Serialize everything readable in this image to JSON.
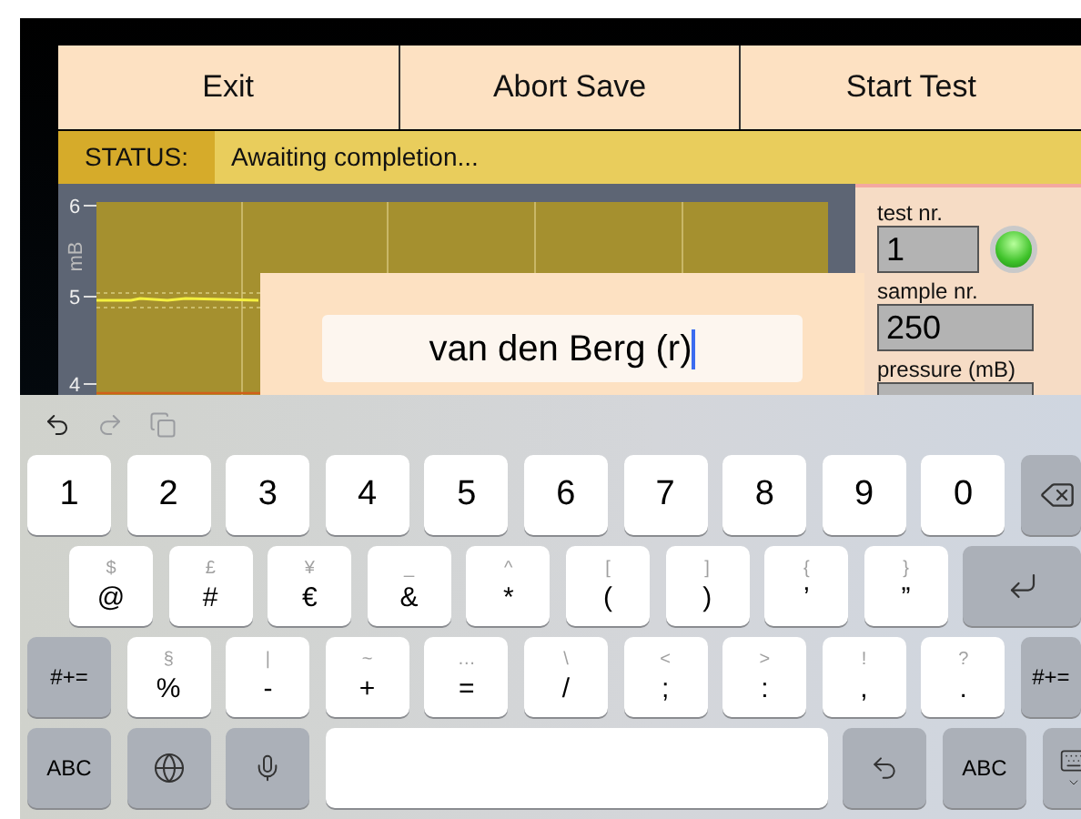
{
  "buttons": [
    "Exit",
    "Abort Save",
    "Start Test"
  ],
  "status": {
    "label": "STATUS:",
    "message": "Awaiting completion..."
  },
  "chart": {
    "ylabel": "mB",
    "yticks": [
      "6",
      "5",
      "4"
    ]
  },
  "panel": {
    "fields": [
      {
        "label": "test nr.",
        "value": "1",
        "led_on": true
      },
      {
        "label": "sample nr.",
        "value": "250"
      },
      {
        "label": "pressure (mB)"
      }
    ]
  },
  "dialog": {
    "value": "van den Berg (r)"
  },
  "keyboard": {
    "tools": [
      {
        "kind": "undo",
        "disabled": false
      },
      {
        "kind": "redo",
        "disabled": true
      },
      {
        "kind": "copy",
        "disabled": true
      }
    ],
    "rows": [
      [
        {
          "kind": "char",
          "label": "1"
        },
        {
          "kind": "char",
          "label": "2"
        },
        {
          "kind": "char",
          "label": "3"
        },
        {
          "kind": "char",
          "label": "4"
        },
        {
          "kind": "char",
          "label": "5"
        },
        {
          "kind": "char",
          "label": "6"
        },
        {
          "kind": "char",
          "label": "7"
        },
        {
          "kind": "char",
          "label": "8"
        },
        {
          "kind": "char",
          "label": "9"
        },
        {
          "kind": "char",
          "label": "0"
        },
        {
          "kind": "delete"
        }
      ],
      [
        {
          "kind": "char",
          "label": "@",
          "alt": "$"
        },
        {
          "kind": "char",
          "label": "#",
          "alt": "£"
        },
        {
          "kind": "char",
          "label": "€",
          "alt": "¥"
        },
        {
          "kind": "char",
          "label": "&",
          "alt": "_"
        },
        {
          "kind": "char",
          "label": "*",
          "alt": "^"
        },
        {
          "kind": "char",
          "label": "(",
          "alt": "["
        },
        {
          "kind": "char",
          "label": ")",
          "alt": "]"
        },
        {
          "kind": "char",
          "label": "’",
          "alt": "{"
        },
        {
          "kind": "char",
          "label": "”",
          "alt": "}"
        },
        {
          "kind": "return"
        }
      ],
      [
        {
          "kind": "mode",
          "label": "#+="
        },
        {
          "kind": "char",
          "label": "%",
          "alt": "§"
        },
        {
          "kind": "char",
          "label": "-",
          "alt": "|"
        },
        {
          "kind": "char",
          "label": "+",
          "alt": "~"
        },
        {
          "kind": "char",
          "label": "=",
          "alt": "…"
        },
        {
          "kind": "char",
          "label": "/",
          "alt": "\\"
        },
        {
          "kind": "char",
          "label": ";",
          "alt": "<"
        },
        {
          "kind": "char",
          "label": ":",
          "alt": ">"
        },
        {
          "kind": "char",
          "label": ",",
          "alt": "!"
        },
        {
          "kind": "char",
          "label": ".",
          "alt": "?"
        },
        {
          "kind": "mode",
          "label": "#+="
        }
      ],
      [
        {
          "kind": "mode",
          "label": "ABC"
        },
        {
          "kind": "globe"
        },
        {
          "kind": "mic"
        },
        {
          "kind": "space"
        },
        {
          "kind": "undo"
        },
        {
          "kind": "mode",
          "label": "ABC"
        },
        {
          "kind": "hide"
        }
      ]
    ]
  }
}
